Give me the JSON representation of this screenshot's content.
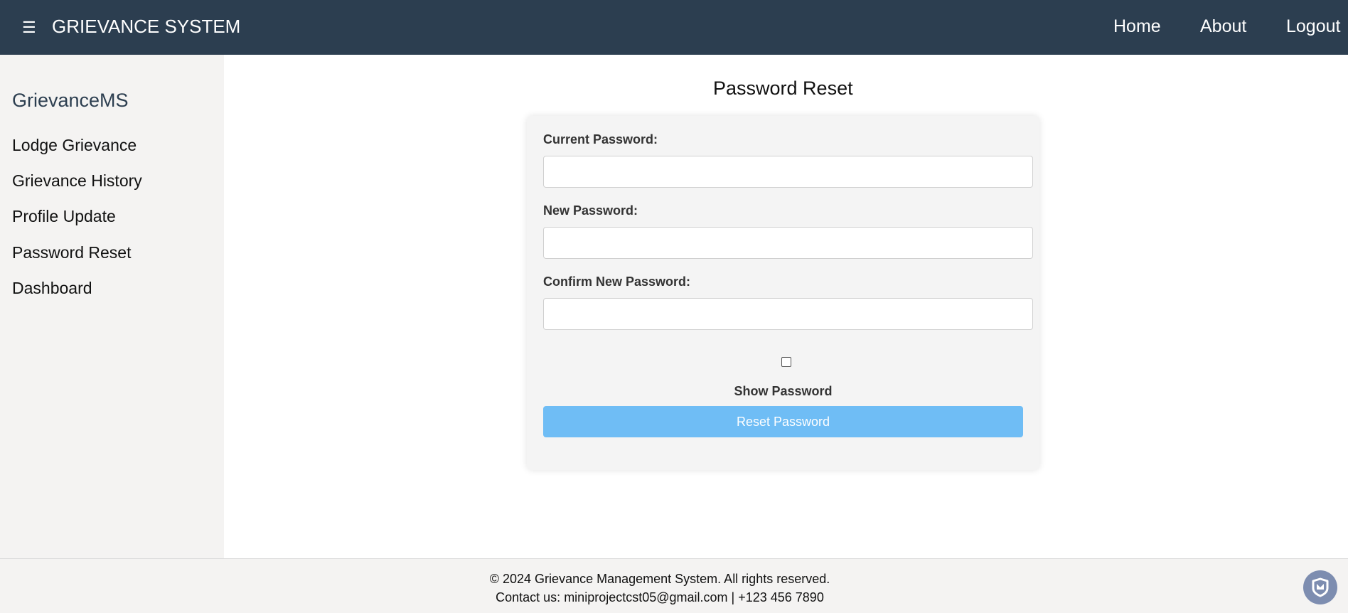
{
  "header": {
    "menu_icon": "hamburger-icon",
    "menu_glyph": "☰",
    "title": "GRIEVANCE SYSTEM",
    "nav": {
      "home": "Home",
      "about": "About",
      "logout": "Logout"
    }
  },
  "sidebar": {
    "title": "GrievanceMS",
    "items": [
      {
        "label": "Lodge Grievance"
      },
      {
        "label": "Grievance History"
      },
      {
        "label": "Profile Update"
      },
      {
        "label": "Password Reset"
      },
      {
        "label": "Dashboard"
      }
    ]
  },
  "main": {
    "title": "Password Reset",
    "form": {
      "current_label": "Current Password:",
      "current_value": "",
      "new_label": "New Password:",
      "new_value": "",
      "confirm_label": "Confirm New Password:",
      "confirm_value": "",
      "show_password_checked": false,
      "show_password_label": "Show Password",
      "submit_label": "Reset Password"
    }
  },
  "footer": {
    "copyright": "© 2024 Grievance Management System. All rights reserved.",
    "contact": "Contact us: miniprojectcst05@gmail.com | +123 456 7890"
  },
  "widget": {
    "icon": "shield-icon"
  },
  "colors": {
    "header_bg": "#2c3e50",
    "sidebar_bg": "#f4f3f2",
    "button_bg": "#6fbdf5",
    "badge_bg": "#7d8db0"
  }
}
